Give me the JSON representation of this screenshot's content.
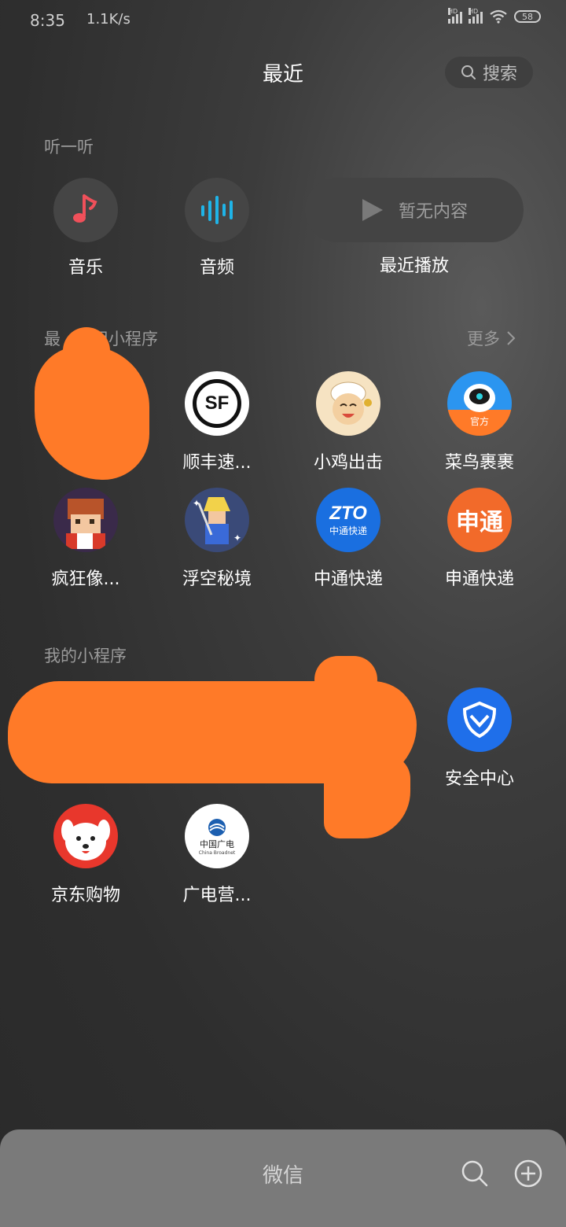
{
  "status_bar": {
    "time": "8:35",
    "speed": "1.1K/s",
    "battery": "58",
    "network_labels": [
      "HD",
      "HD"
    ]
  },
  "header": {
    "title": "最近",
    "search_label": "搜索"
  },
  "listen": {
    "section_label": "听一听",
    "items": [
      {
        "label": "音乐",
        "icon": "music-note-icon",
        "color": "#f0505a"
      },
      {
        "label": "音频",
        "icon": "audio-wave-icon",
        "color": "#1fb4e8"
      }
    ],
    "recent_play": {
      "empty_text": "暂无内容",
      "label": "最近播放"
    }
  },
  "recent_mini": {
    "section_label_visible": "最      用小程序",
    "more_label": "更多",
    "apps": [
      {
        "name": "顺丰速...",
        "icon": "sf-express-icon",
        "icon_text": "SF"
      },
      {
        "name": "小鸡出击",
        "icon": "chick-game-icon"
      },
      {
        "name": "菜鸟裹裹",
        "icon": "cainiao-icon",
        "badge": "官方"
      },
      {
        "name": "疯狂像...",
        "icon": "pixel-game-icon"
      },
      {
        "name": "浮空秘境",
        "icon": "floating-realm-icon"
      },
      {
        "name": "中通快递",
        "icon": "zto-icon",
        "icon_text": "ZTO",
        "icon_sub": "中通快递"
      },
      {
        "name": "申通快递",
        "icon": "sto-icon",
        "icon_text": "申通"
      }
    ]
  },
  "my_mini": {
    "section_label": "我的小程序",
    "apps": [
      {
        "name": "安全中心",
        "icon": "security-shield-icon"
      },
      {
        "name": "京东购物",
        "icon": "jd-dog-icon"
      },
      {
        "name": "广电营...",
        "icon": "china-broadnet-icon",
        "icon_text": "中国广电",
        "icon_sub": "China Broadnet"
      }
    ]
  },
  "bottom_bar": {
    "title": "微信",
    "search_icon": "search-icon",
    "add_icon": "plus-circle-icon"
  },
  "colors": {
    "redaction": "#ff7a28",
    "background": "#2e2e2e"
  }
}
